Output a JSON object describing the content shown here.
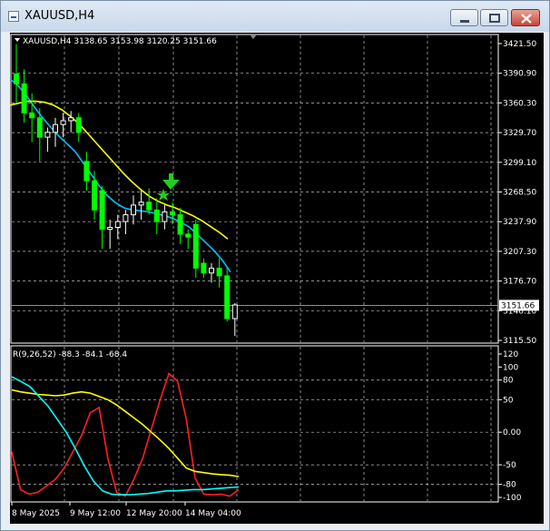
{
  "window": {
    "title": "XAUUSD,H4"
  },
  "chart_header": {
    "text": "XAUUSD,H4  3138.65 3153.98 3120.25 3151.66"
  },
  "price_axis": {
    "ticks": [
      "3421.50",
      "3390.90",
      "3360.30",
      "3329.70",
      "3299.10",
      "3268.50",
      "3237.90",
      "3207.30",
      "3176.70",
      "3146.10",
      "3115.50"
    ],
    "current_price": "3151.66"
  },
  "indicator": {
    "label": "R(9,26,52) -88.3 -84.1 -68.4",
    "ticks": [
      "120",
      "100",
      "80",
      "50",
      "0.00",
      "-50",
      "-80",
      "-100"
    ]
  },
  "time_axis": {
    "labels": [
      "8 May 2025",
      "9 May 12:00",
      "12 May 20:00",
      "14 May 04:00"
    ]
  },
  "colors": {
    "background": "#000000",
    "bull_candle": "#ffffff",
    "bear_candle": "#00ff00",
    "ma_fast": "#00bfff",
    "ma_slow": "#ffff00",
    "osc_red": "#ff2020",
    "osc_yellow": "#ffff00",
    "osc_cyan": "#00ffff",
    "signal_marker": "#22cc22"
  },
  "icons": {
    "window_icon": "chart-window-icon",
    "minimize": "minimize-icon",
    "maximize": "maximize-icon",
    "close": "close-icon",
    "signal_arrow": "down-arrow-signal-icon",
    "signal_star": "star-signal-icon"
  },
  "chart_data": [
    {
      "type": "candlestick",
      "title": "XAUUSD,H4",
      "ylim": [
        3115.5,
        3421.5
      ],
      "candles": [
        {
          "o": 3390,
          "h": 3421,
          "l": 3360,
          "c": 3380
        },
        {
          "o": 3380,
          "h": 3395,
          "l": 3340,
          "c": 3350
        },
        {
          "o": 3350,
          "h": 3370,
          "l": 3320,
          "c": 3345
        },
        {
          "o": 3345,
          "h": 3355,
          "l": 3300,
          "c": 3325
        },
        {
          "o": 3325,
          "h": 3335,
          "l": 3310,
          "c": 3330
        },
        {
          "o": 3330,
          "h": 3345,
          "l": 3315,
          "c": 3338
        },
        {
          "o": 3338,
          "h": 3350,
          "l": 3325,
          "c": 3342
        },
        {
          "o": 3342,
          "h": 3352,
          "l": 3330,
          "c": 3345
        },
        {
          "o": 3345,
          "h": 3350,
          "l": 3320,
          "c": 3330
        },
        {
          "o": 3300,
          "h": 3310,
          "l": 3270,
          "c": 3280
        },
        {
          "o": 3280,
          "h": 3290,
          "l": 3240,
          "c": 3250
        },
        {
          "o": 3270,
          "h": 3275,
          "l": 3210,
          "c": 3230
        },
        {
          "o": 3230,
          "h": 3240,
          "l": 3210,
          "c": 3232
        },
        {
          "o": 3232,
          "h": 3245,
          "l": 3220,
          "c": 3238
        },
        {
          "o": 3238,
          "h": 3250,
          "l": 3225,
          "c": 3245
        },
        {
          "o": 3245,
          "h": 3265,
          "l": 3235,
          "c": 3255
        },
        {
          "o": 3255,
          "h": 3270,
          "l": 3240,
          "c": 3258
        },
        {
          "o": 3258,
          "h": 3272,
          "l": 3245,
          "c": 3250
        },
        {
          "o": 3250,
          "h": 3262,
          "l": 3225,
          "c": 3238
        },
        {
          "o": 3238,
          "h": 3255,
          "l": 3230,
          "c": 3248
        },
        {
          "o": 3248,
          "h": 3258,
          "l": 3235,
          "c": 3245
        },
        {
          "o": 3245,
          "h": 3252,
          "l": 3215,
          "c": 3225
        },
        {
          "o": 3225,
          "h": 3230,
          "l": 3210,
          "c": 3222
        },
        {
          "o": 3235,
          "h": 3240,
          "l": 3180,
          "c": 3190
        },
        {
          "o": 3195,
          "h": 3200,
          "l": 3180,
          "c": 3185
        },
        {
          "o": 3185,
          "h": 3195,
          "l": 3175,
          "c": 3190
        },
        {
          "o": 3190,
          "h": 3200,
          "l": 3170,
          "c": 3182
        },
        {
          "o": 3182,
          "h": 3190,
          "l": 3135,
          "c": 3138
        },
        {
          "o": 3138,
          "h": 3154,
          "l": 3120,
          "c": 3152
        }
      ],
      "ma_fast": [
        3385,
        3378,
        3368,
        3356,
        3345,
        3335,
        3326,
        3318,
        3310,
        3298,
        3286,
        3274,
        3264,
        3257,
        3252,
        3250,
        3249,
        3248,
        3246,
        3244,
        3241,
        3237,
        3232,
        3224,
        3216,
        3208,
        3198,
        3186
      ],
      "ma_slow": [
        3358,
        3360,
        3362,
        3362,
        3361,
        3358,
        3353,
        3346,
        3338,
        3328,
        3318,
        3308,
        3298,
        3288,
        3279,
        3271,
        3264,
        3259,
        3255,
        3252,
        3248,
        3244,
        3239,
        3233,
        3227,
        3220
      ],
      "current_price": 3151.66
    },
    {
      "type": "line",
      "title": "R(9,26,52)",
      "ylim": [
        -100,
        120
      ],
      "series": [
        {
          "name": "R(9)",
          "values": [
            -30,
            -88,
            -95,
            -92,
            -82,
            -72,
            -55,
            -30,
            -5,
            30,
            38,
            -40,
            -92,
            -98,
            -72,
            -40,
            5,
            50,
            90,
            78,
            20,
            -70,
            -95,
            -96,
            -95,
            -98,
            -88
          ]
        },
        {
          "name": "R(26)",
          "values": [
            65,
            62,
            60,
            58,
            57,
            56,
            57,
            60,
            62,
            60,
            55,
            50,
            42,
            32,
            22,
            12,
            0,
            -12,
            -25,
            -40,
            -55,
            -60,
            -62,
            -64,
            -65,
            -66,
            -68
          ]
        },
        {
          "name": "R(52)",
          "values": [
            85,
            78,
            70,
            55,
            40,
            20,
            0,
            -25,
            -52,
            -75,
            -90,
            -95,
            -96,
            -96,
            -95,
            -94,
            -92,
            -90,
            -90,
            -89,
            -88,
            -88,
            -87,
            -86,
            -85,
            -84
          ]
        }
      ]
    }
  ]
}
